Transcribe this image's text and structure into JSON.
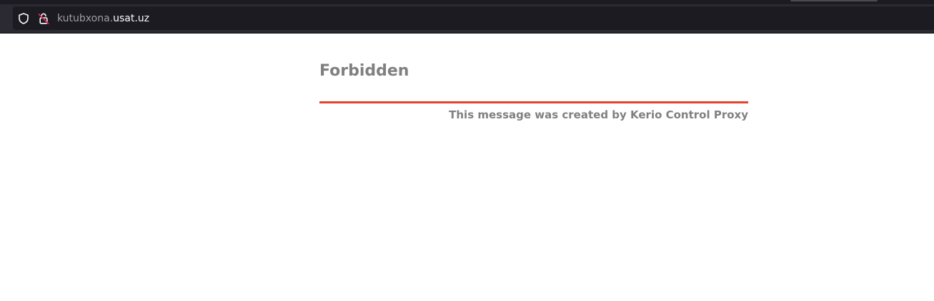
{
  "browser": {
    "url_prefix": "kutubxona.",
    "url_domain": "usat.uz",
    "icons": {
      "tracking": "shield-icon",
      "security": "insecure-lock-icon"
    }
  },
  "page": {
    "heading": "Forbidden",
    "message": "This message was created by Kerio Control Proxy"
  },
  "colors": {
    "accent_rule": "#e4412f",
    "text": "#808080",
    "toolbar": "#2b2a33",
    "urlbar": "#1c1b22"
  }
}
